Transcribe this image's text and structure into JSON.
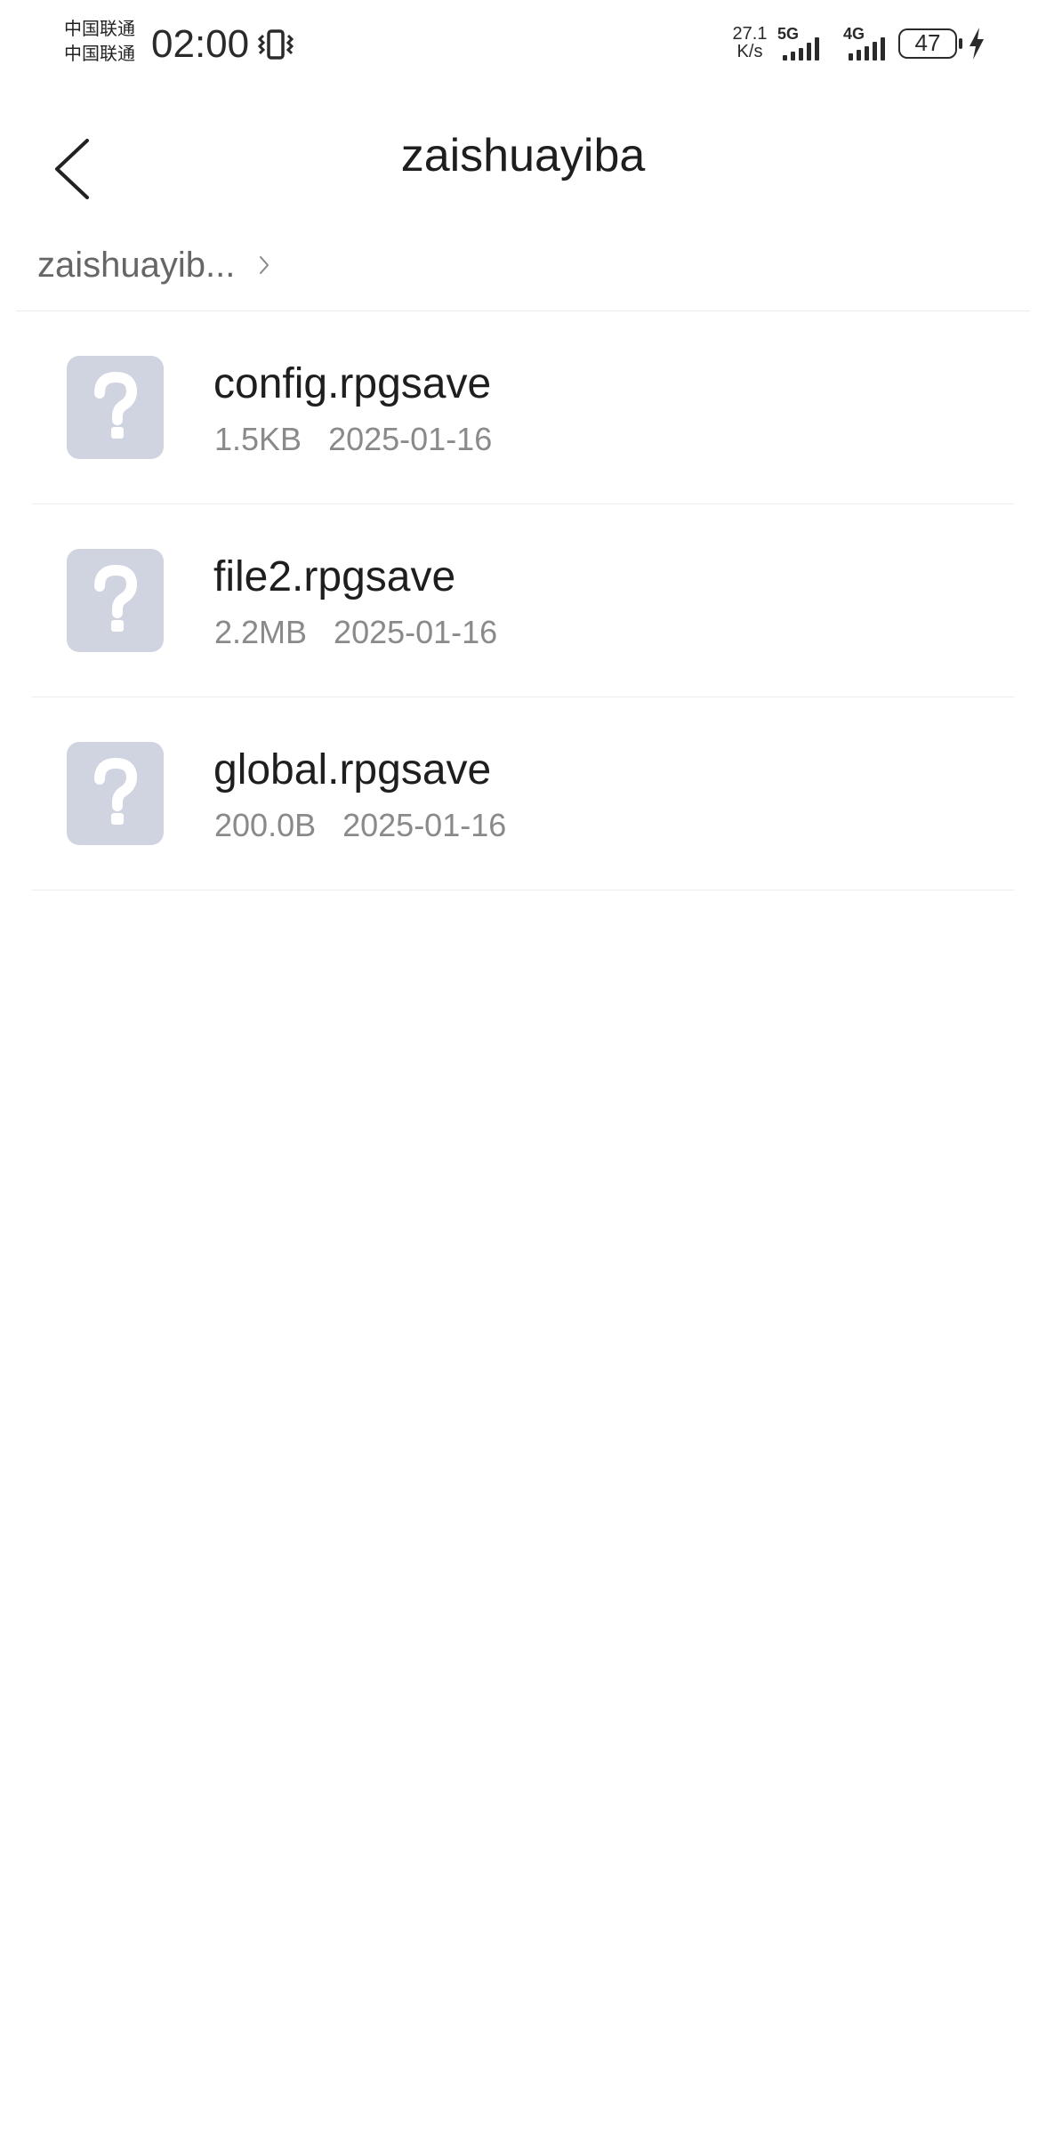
{
  "status_bar": {
    "carrier_1": "中国联通",
    "carrier_2": "中国联通",
    "time": "02:00",
    "net_speed_value": "27.1",
    "net_speed_unit": "K/s",
    "network_1": "5G",
    "network_2": "4G",
    "battery_level": "47",
    "icons": [
      "vibrate-icon",
      "signal-icon",
      "signal-icon",
      "battery-icon",
      "charging-icon"
    ]
  },
  "header": {
    "back_icon": "chevron-left-icon",
    "title": "zaishuayiba"
  },
  "breadcrumb": {
    "path": "zaishuayib...",
    "separator_icon": "chevron-right-icon"
  },
  "files": [
    {
      "name": "config.rpgsave",
      "size": "1.5KB",
      "date": "2025-01-16",
      "icon": "unknown-file-icon"
    },
    {
      "name": "file2.rpgsave",
      "size": "2.2MB",
      "date": "2025-01-16",
      "icon": "unknown-file-icon"
    },
    {
      "name": "global.rpgsave",
      "size": "200.0B",
      "date": "2025-01-16",
      "icon": "unknown-file-icon"
    }
  ],
  "colors": {
    "background": "#ffffff",
    "file_icon_bg": "#cfd4e0",
    "divider": "#ececec",
    "meta_text": "#8a8a8a"
  }
}
